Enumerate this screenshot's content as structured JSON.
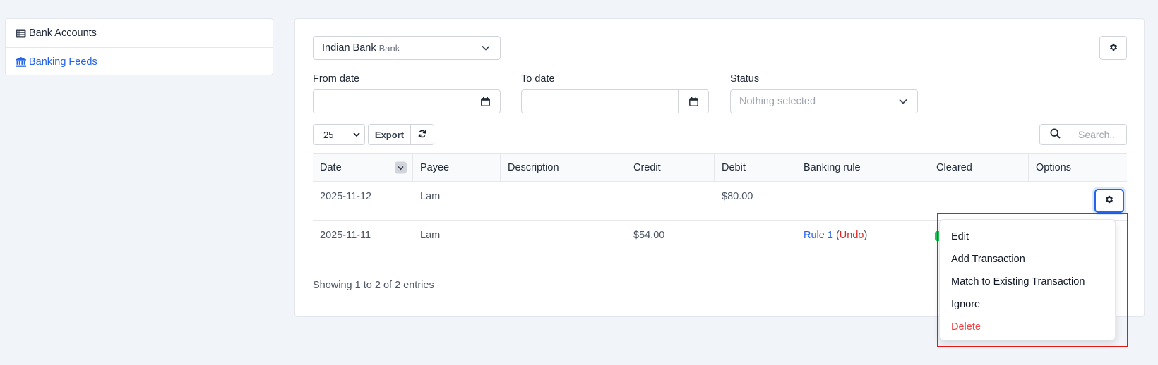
{
  "sidebar": {
    "items": [
      {
        "label": "Bank Accounts",
        "icon": "list-icon"
      },
      {
        "label": "Banking Feeds",
        "icon": "bank-icon"
      }
    ]
  },
  "filters": {
    "account_name": "Indian Bank",
    "account_type": "Bank",
    "from_date_label": "From date",
    "to_date_label": "To date",
    "status_label": "Status",
    "status_placeholder": "Nothing selected",
    "from_date_value": "",
    "to_date_value": ""
  },
  "toolbar": {
    "page_length": "25",
    "export_label": "Export",
    "search_placeholder": "Search.."
  },
  "table": {
    "headers": [
      "Date",
      "Payee",
      "Description",
      "Credit",
      "Debit",
      "Banking rule",
      "Cleared",
      "Options"
    ],
    "rows": [
      {
        "date": "2025-11-12",
        "payee": "Lam",
        "description": "",
        "credit": "",
        "debit": "$80.00",
        "rule": "",
        "cleared": ""
      },
      {
        "date": "2025-11-11",
        "payee": "Lam",
        "description": "",
        "credit": "$54.00",
        "debit": "",
        "rule": "Rule 1",
        "rule_paren_open": "(",
        "rule_undo": "Undo",
        "rule_paren_close": ")",
        "cleared": ""
      }
    ],
    "info": "Showing 1 to 2 of 2 entries"
  },
  "dropdown": {
    "items": [
      "Edit",
      "Add Transaction",
      "Match to Existing Transaction",
      "Ignore",
      "Delete"
    ]
  },
  "colors": {
    "accent": "#2563eb",
    "danger": "#ef4444",
    "highlight": "#e01818"
  }
}
